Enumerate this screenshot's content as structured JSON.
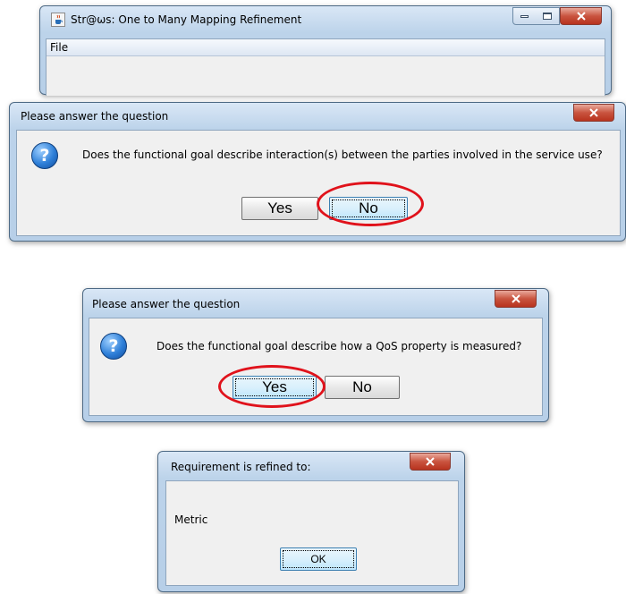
{
  "main_window": {
    "title": "Str@ωs: One to Many Mapping Refinement",
    "menu": {
      "file": "File"
    }
  },
  "dialog1": {
    "title": "Please answer the question",
    "question": "Does the functional goal describe interaction(s) between the parties involved in the service use?",
    "yes": "Yes",
    "no": "No",
    "close": "x"
  },
  "dialog2": {
    "title": "Please answer the question",
    "question": "Does the functional goal describe how a QoS property is measured?",
    "yes": "Yes",
    "no": "No",
    "close": "x"
  },
  "dialog3": {
    "title": "Requirement is refined to:",
    "message": "Metric",
    "ok": "OK",
    "close": "x"
  },
  "icons": {
    "app": "java-cup-icon",
    "question": "question-icon"
  }
}
